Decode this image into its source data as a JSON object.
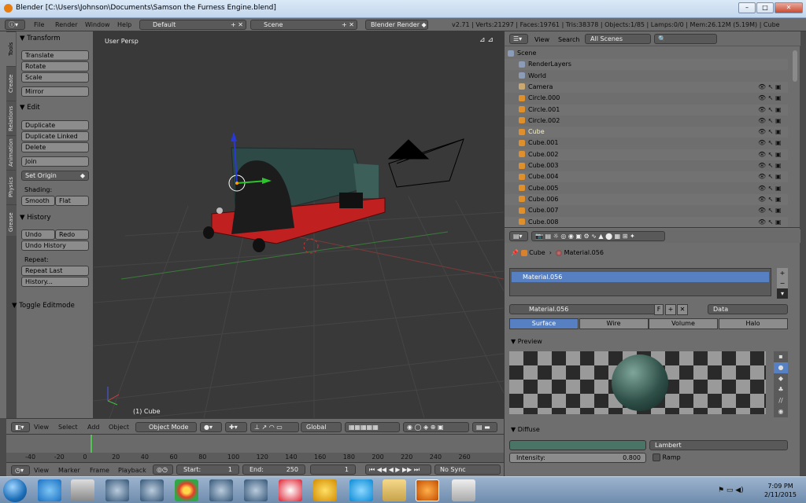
{
  "window": {
    "title": "Blender [C:\\Users\\Johnson\\Documents\\Samson the Furness Engine.blend]",
    "min": "–",
    "max": "□",
    "close": "✕"
  },
  "info": {
    "menus": [
      "File",
      "Render",
      "Window",
      "Help"
    ],
    "layout": "Default",
    "scene": "Scene",
    "engine": "Blender Render",
    "stats": "v2.71 | Verts:21297 | Faces:19761 | Tris:38378 | Objects:1/85 | Lamps:0/0 | Mem:26.12M (5.19M) | Cube"
  },
  "tool_tabs": [
    "Tools",
    "Create",
    "Relations",
    "Animation",
    "Physics",
    "Grease Pencil"
  ],
  "tools": {
    "transform": "Transform",
    "translate": "Translate",
    "rotate": "Rotate",
    "scale": "Scale",
    "mirror": "Mirror",
    "edit": "Edit",
    "duplicate": "Duplicate",
    "duplicate_linked": "Duplicate Linked",
    "delete": "Delete",
    "join": "Join",
    "set_origin": "Set Origin",
    "shading": "Shading:",
    "smooth": "Smooth",
    "flat": "Flat",
    "history": "History",
    "undo": "Undo",
    "redo": "Redo",
    "undo_history": "Undo History",
    "repeat": "Repeat:",
    "repeat_last": "Repeat Last",
    "history_btn": "History...",
    "toggle_editmode": "Toggle Editmode"
  },
  "viewport": {
    "view_label": "User Persp",
    "object_label": "(1) Cube"
  },
  "vp_header": {
    "view": "View",
    "select": "Select",
    "add": "Add",
    "object": "Object",
    "mode": "Object Mode",
    "orientation": "Global"
  },
  "timeline": {
    "ticks": [
      "-40",
      "-20",
      "0",
      "20",
      "40",
      "60",
      "80",
      "100",
      "120",
      "140",
      "160",
      "180",
      "200",
      "220",
      "240",
      "260"
    ],
    "view": "View",
    "marker": "Marker",
    "frame": "Frame",
    "playback": "Playback",
    "start_label": "Start:",
    "start": "1",
    "end_label": "End:",
    "end": "250",
    "current": "1",
    "sync": "No Sync"
  },
  "outliner": {
    "view": "View",
    "search": "Search",
    "filter": "All Scenes",
    "rows": [
      "Scene",
      "RenderLayers",
      "World",
      "Camera",
      "Circle.000",
      "Circle.001",
      "Circle.002",
      "Cube",
      "Cube.001",
      "Cube.002",
      "Cube.003",
      "Cube.004",
      "Cube.005",
      "Cube.006",
      "Cube.007",
      "Cube.008"
    ]
  },
  "properties": {
    "crumb_object": "Cube",
    "crumb_material": "Material.056",
    "slot": "Material.056",
    "material_name": "Material.056",
    "f_flag": "F",
    "link": "Data",
    "tabs": [
      "Surface",
      "Wire",
      "Volume",
      "Halo"
    ],
    "active_tab": "Surface",
    "preview": "Preview",
    "diffuse": "Diffuse",
    "shader": "Lambert",
    "intensity_label": "Intensity:",
    "intensity": "0.800",
    "ramp": "Ramp",
    "diffuse_color": "#4a7466"
  },
  "taskbar": {
    "time": "7:09 PM",
    "date": "2/11/2015"
  },
  "colors": {
    "selected": "#5680c2",
    "engine_red": "#c0201f",
    "engine_teal": "#2e4a46"
  }
}
